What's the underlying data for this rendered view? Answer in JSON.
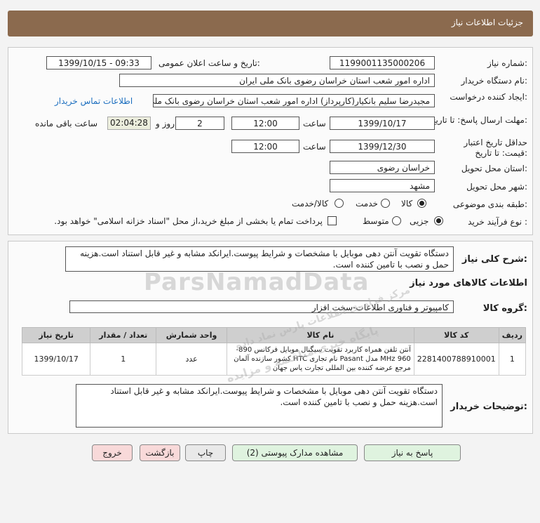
{
  "header": {
    "title": "جزئیات اطلاعات نیاز"
  },
  "form": {
    "need_number_label": "شماره نیاز:",
    "need_number": "1199001135000206",
    "announce_label": "تاریخ و ساعت اعلان عمومی:",
    "announce_value": "1399/10/15 - 09:33",
    "buyer_org_label": "نام دستگاه خریدار:",
    "buyer_org": "اداره امور شعب استان خراسان رضوی بانک ملی ایران",
    "requester_label": "ایجاد کننده درخواست:",
    "requester": "مجیدرضا سلیم  بانکیار(کارپرداز) اداره امور شعب استان خراسان رضوی بانک ملی ایران",
    "contact_link": "اطلاعات تماس خریدار",
    "deadline_label": "مهلت ارسال پاسخ: تا تاریخ:",
    "deadline_date": "1399/10/17",
    "time_label": "ساعت",
    "deadline_time": "12:00",
    "days_value": "2",
    "days_label": "روز و",
    "timer": "02:04:28",
    "remaining_label": "ساعت باقی مانده",
    "validity_label": "حداقل تاریخ اعتبار قیمت: تا تاریخ:",
    "validity_date": "1399/12/30",
    "validity_time": "12:00",
    "province_label": "استان محل تحویل:",
    "province": "خراسان رضوی",
    "city_label": "شهر محل تحویل:",
    "city": "مشهد",
    "category_label": "طبقه بندی موضوعی:",
    "category_options": [
      "کالا",
      "خدمت",
      "کالا/خدمت"
    ],
    "process_label": "نوع فرآیند خرید :",
    "process_options": [
      "جزیی",
      "متوسط"
    ],
    "payment_note": "پرداخت تمام یا بخشی از مبلغ خرید،از محل \"اسناد خزانه اسلامی\" خواهد بود."
  },
  "summary": {
    "label": "شرح کلی نیاز:",
    "text": "دستگاه تقویت آنتن دهی موبایل با مشخصات و شرایط پیوست.ایرانکد مشابه و غیر قابل استناد است.هزینه حمل و نصب با تامین کننده است."
  },
  "goods": {
    "section_title": "اطلاعات کالاهای مورد نیاز",
    "group_label": "گروه کالا:",
    "group_value": "کامپیوتر و فناوری اطلاعات-سخت افزار",
    "columns": [
      "ردیف",
      "کد کالا",
      "نام کالا",
      "واحد شمارش",
      "تعداد / مقدار",
      "تاریخ نیاز"
    ],
    "rows": [
      {
        "row": "1",
        "code": "2281400788910001",
        "name": "آنتن تلفن همراه کاربرد تقویت سیگنال موبایل فرکانس 890-960 MHz مدل Pasant نام تجاری HTC کشور سازنده آلمان مرجع عرضه کننده بین المللی تجارت یاس جهان",
        "unit": "عدد",
        "qty": "1",
        "date": "1399/10/17"
      }
    ]
  },
  "buyer_notes": {
    "label": "توضیحات خریدار:",
    "text": "دستگاه تقویت آنتن دهی موبایل با مشخصات و شرایط پیوست.ایرانکد مشابه و غیر قابل استناد است.هزینه حمل و نصب با تامین کننده است."
  },
  "buttons": {
    "reply": "پاسخ به نیاز",
    "attachments": "مشاهده مدارک پیوستی (2)",
    "print": "چاپ",
    "back": "بازگشت",
    "exit": "خروج"
  },
  "watermark": {
    "main": "ParsNamadData",
    "sub": "پایگاه خبری مناقصه و مزایده",
    "sub2": "مرکز فراوری اطلاعات پارس نماد داده"
  }
}
